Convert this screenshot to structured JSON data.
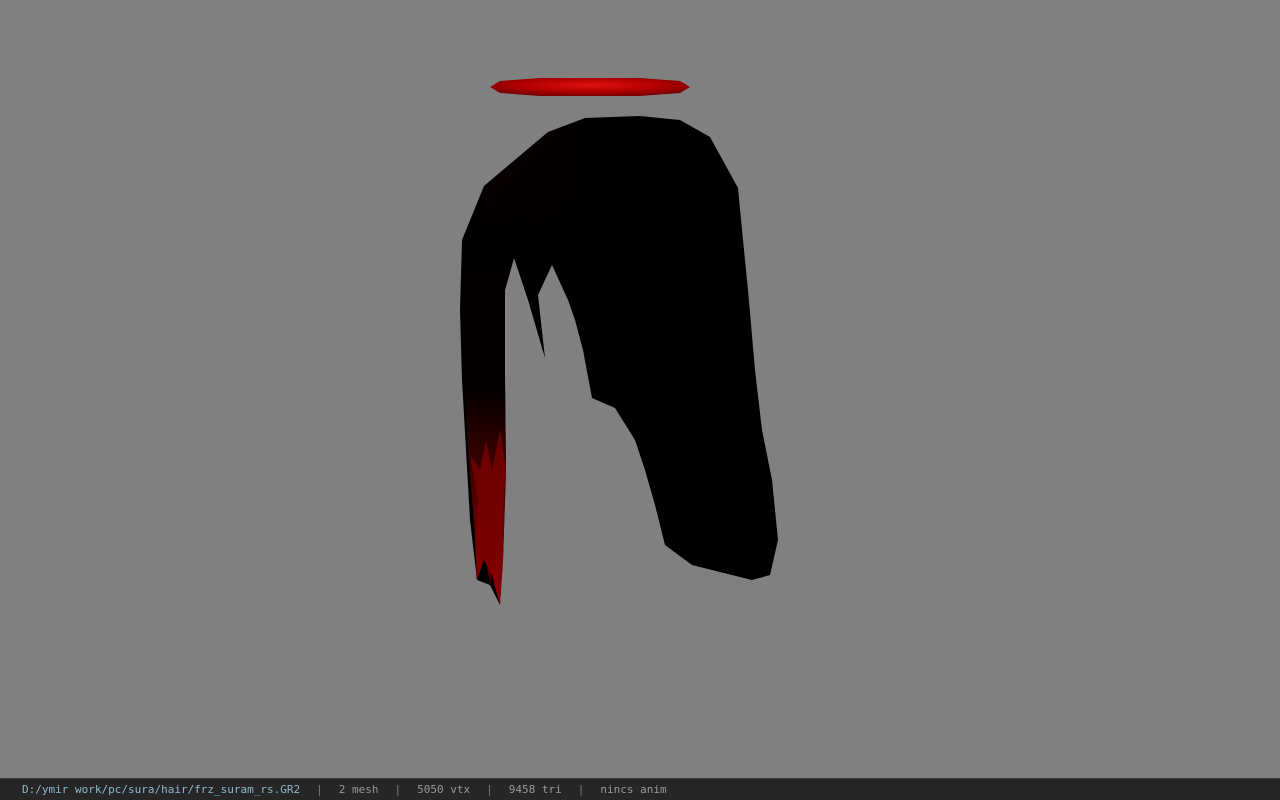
{
  "viewport": {
    "background_color": "#808080",
    "model": {
      "halo_color": "#c00000",
      "hair_color": "#000000",
      "hair_tip_color": "#8a0000"
    }
  },
  "statusbar": {
    "file_path": "D:/ymir work/pc/sura/hair/frz_suram_rs.GR2",
    "separator": "|",
    "mesh_count": "2 mesh",
    "vertex_count": "5050 vtx",
    "triangle_count": "9458 tri",
    "anim_status": "nincs anim"
  }
}
